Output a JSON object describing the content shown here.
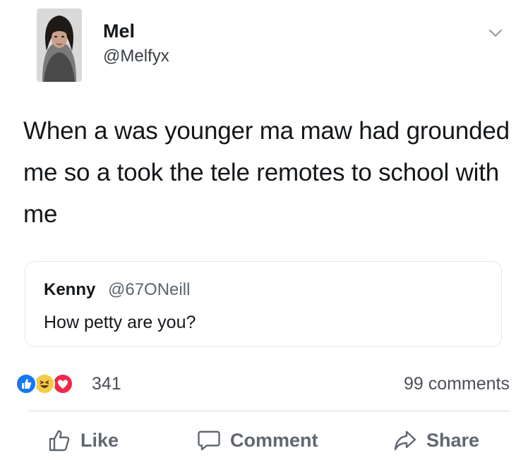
{
  "tweet": {
    "author_name": "Mel",
    "author_handle": "@Melfyx",
    "text": "When a was younger ma maw had grounded me so a took the tele remotes to school with me"
  },
  "quote": {
    "author_name": "Kenny",
    "author_handle": "@67ONeill",
    "text": "How petty are you?"
  },
  "stats": {
    "reaction_count": "341",
    "comment_count": "99 comments"
  },
  "actions": {
    "like_label": "Like",
    "comment_label": "Comment",
    "share_label": "Share"
  },
  "icons": {
    "reactions": [
      "like-reaction-icon",
      "haha-reaction-icon",
      "love-reaction-icon"
    ],
    "menu": "chevron-down-icon"
  },
  "colors": {
    "like_blue": "#1877f2",
    "haha_yellow": "#f7c948",
    "love_red": "#f0284a",
    "action_gray": "#606770"
  }
}
